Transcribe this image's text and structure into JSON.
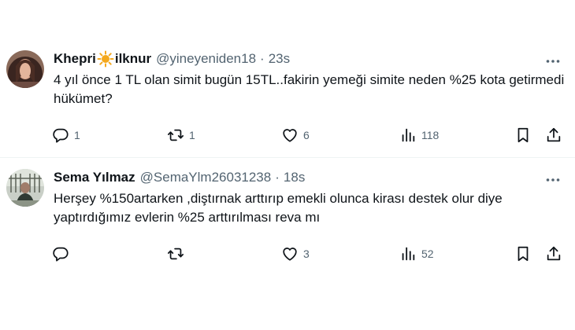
{
  "tweets": [
    {
      "name_part1": "Khepri",
      "name_part2": "ilknur",
      "name_emoji": "sun",
      "handle": "@yineyeniden18",
      "separator": "·",
      "time": "23s",
      "text": "4 yıl önce 1 TL olan simit bugün 15TL..fakirin yemeği simite neden %25 kota getirmedi hükümet?",
      "replies": "1",
      "retweets": "1",
      "likes": "6",
      "views": "118"
    },
    {
      "name": "Sema Yılmaz",
      "handle": "@SemaYlm26031238",
      "separator": "·",
      "time": "18s",
      "text": "Herşey %150artarken ,diştırnak arttırıp emekli olunca kirası destek olur diye yaptırdığımız evlerin %25 arttırılması reva mı",
      "replies": "",
      "retweets": "",
      "likes": "3",
      "views": "52"
    }
  ],
  "icons": {
    "more": "more-icon",
    "reply": "reply-icon",
    "retweet": "retweet-icon",
    "like": "heart-icon",
    "views": "views-icon",
    "bookmark": "bookmark-icon",
    "share": "share-icon"
  },
  "colors": {
    "text": "#0f1419",
    "secondary": "#536471",
    "divider": "#eff3f4",
    "sun": "#f4a81d"
  }
}
